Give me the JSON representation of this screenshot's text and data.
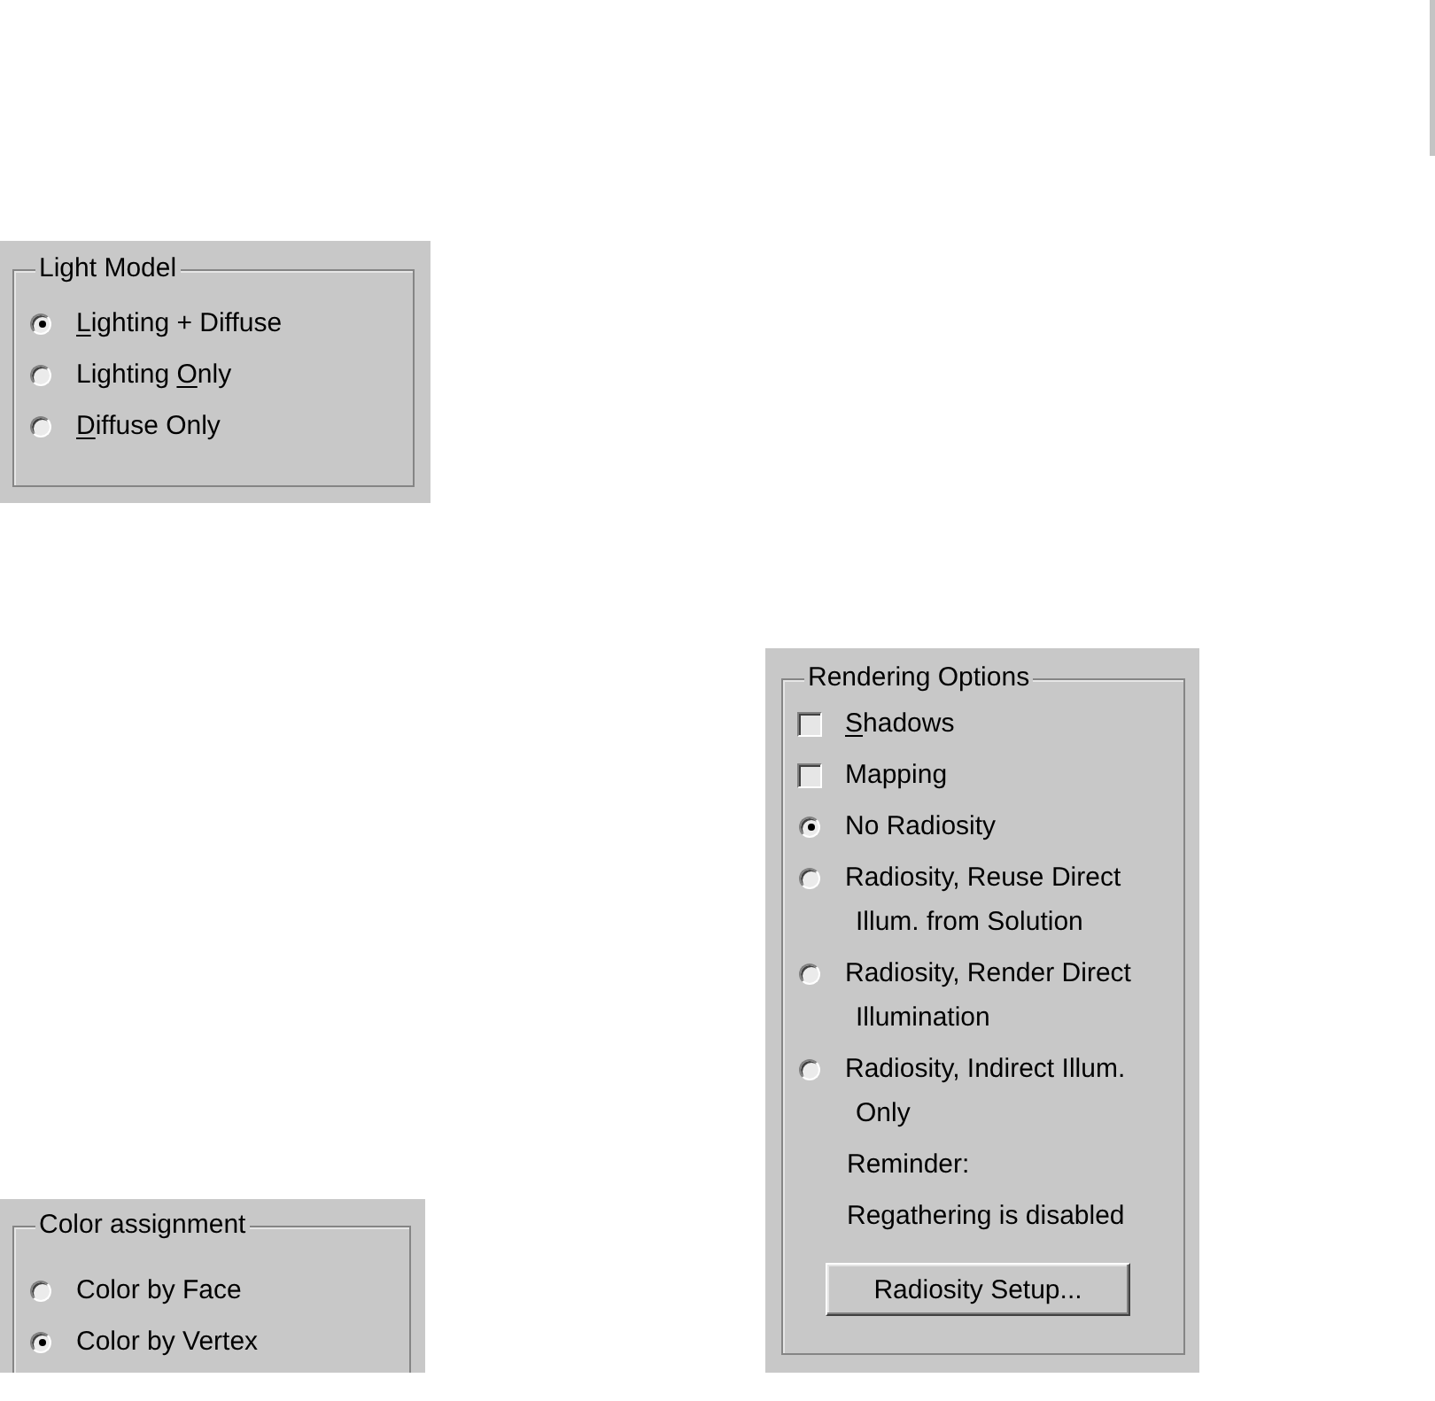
{
  "light_model": {
    "title": "Light Model",
    "options": [
      {
        "parts": [
          {
            "text": "L",
            "underlined": true
          },
          {
            "text": "ighting + Diffuse",
            "underlined": false
          }
        ],
        "selected": true
      },
      {
        "parts": [
          {
            "text": "Lighting ",
            "underlined": false
          },
          {
            "text": "O",
            "underlined": true
          },
          {
            "text": "nly",
            "underlined": false
          }
        ],
        "selected": false
      },
      {
        "parts": [
          {
            "text": "D",
            "underlined": true
          },
          {
            "text": "iffuse Only",
            "underlined": false
          }
        ],
        "selected": false
      }
    ]
  },
  "rendering_options": {
    "title": "Rendering Options",
    "checkboxes": [
      {
        "parts": [
          {
            "text": "S",
            "underlined": true
          },
          {
            "text": "hadows",
            "underlined": false
          }
        ],
        "checked": false
      },
      {
        "parts": [
          {
            "text": "Mapping",
            "underlined": false
          }
        ],
        "checked": false
      }
    ],
    "radiosity_modes": [
      {
        "label": "No Radiosity",
        "selected": true
      },
      {
        "label": "Radiosity, Reuse Direct Illum. from Solution",
        "selected": false
      },
      {
        "label": "Radiosity, Render Direct Illumination",
        "selected": false
      },
      {
        "label": "Radiosity, Indirect Illum. Only",
        "selected": false
      }
    ],
    "notes": [
      "Reminder:",
      "Regathering is disabled"
    ],
    "button": "Radiosity Setup..."
  },
  "color_assignment": {
    "title": "Color assignment",
    "options": [
      {
        "label": "Color by Face",
        "selected": false
      },
      {
        "label": "Color by Vertex",
        "selected": true
      }
    ]
  }
}
